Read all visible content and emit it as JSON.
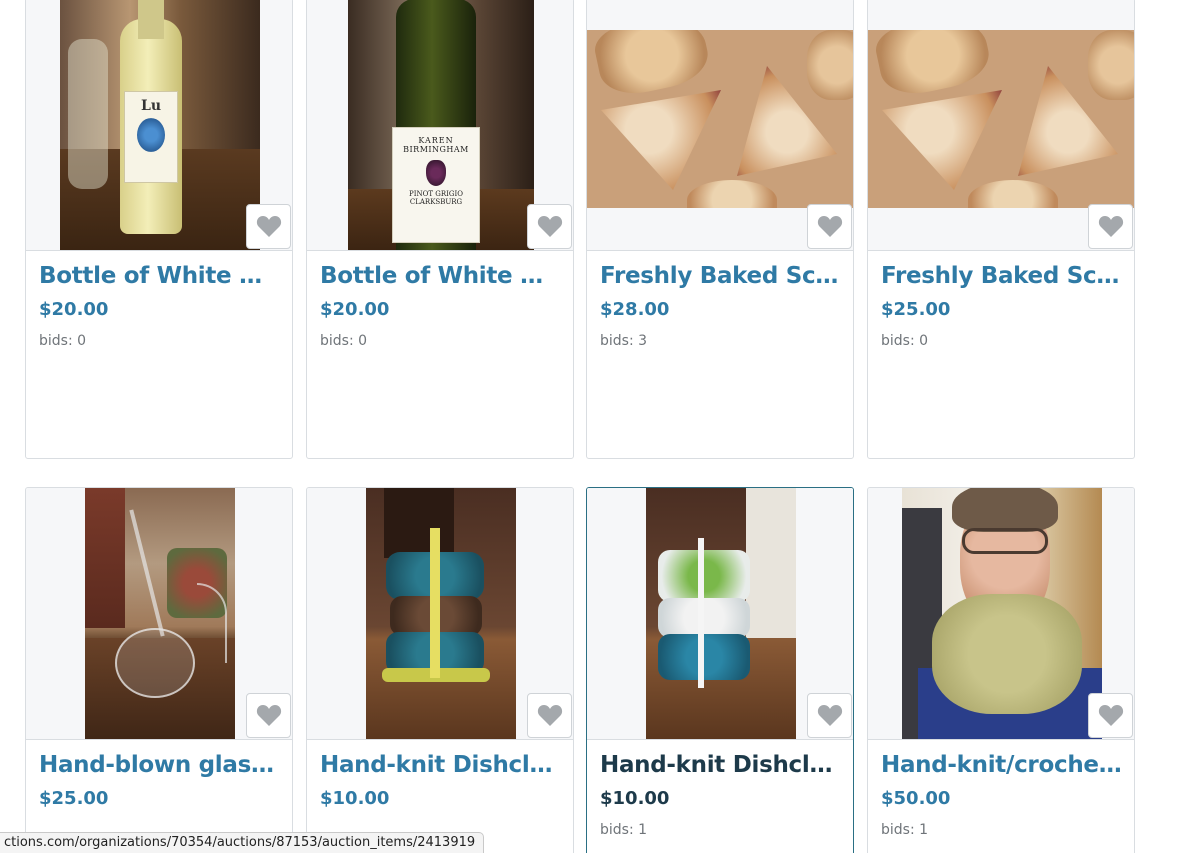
{
  "items": [
    {
      "title": "Bottle of White Win…",
      "price": "$20.00",
      "bids": "bids: 0",
      "image": "white-wine-bottle-photo",
      "bottle_label": "Lu"
    },
    {
      "title": "Bottle of White Win…",
      "price": "$20.00",
      "bids": "bids: 0",
      "image": "white-wine-bottle-photo",
      "bottle_label_line1": "KAREN",
      "bottle_label_line2": "BIRMINGHAM",
      "bottle_label_line3": "PINOT GRIGIO",
      "bottle_label_line4": "CLARKSBURG"
    },
    {
      "title": "Freshly Baked Scones",
      "price": "$28.00",
      "bids": "bids: 3",
      "image": "scones-photo"
    },
    {
      "title": "Freshly Baked Scone…",
      "price": "$25.00",
      "bids": "bids: 0",
      "image": "scones-photo"
    },
    {
      "title": "Hand-blown glass wi…",
      "price": "$25.00",
      "bids": "",
      "image": "glass-decanter-photo"
    },
    {
      "title": "Hand-knit Dishcloth…",
      "price": "$10.00",
      "bids": "",
      "image": "dishcloths-photo"
    },
    {
      "title": "Hand-knit Dishcloth…",
      "price": "$10.00",
      "bids": "bids: 1",
      "image": "dishcloths-photo"
    },
    {
      "title": "Hand-knit/crochete…",
      "price": "$50.00",
      "bids": "bids: 1",
      "image": "knit-cowl-photo"
    }
  ],
  "status_bar": {
    "url": "ctions.com/organizations/70354/auctions/87153/auction_items/2413919"
  },
  "colors": {
    "link": "#2f7aa5",
    "link_hover": "#1d3a4a",
    "muted": "#6f7479",
    "border": "#d9dde1",
    "hover_border": "#2a6f84"
  }
}
